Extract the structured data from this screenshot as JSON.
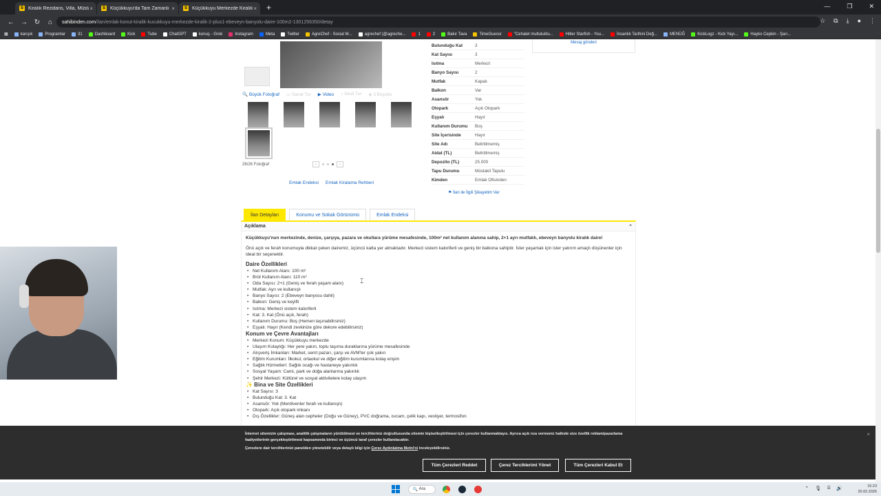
{
  "browser": {
    "tabs": [
      {
        "label": "Kiralık Rezidans, Villa, Müstakil",
        "favicon": "S"
      },
      {
        "label": "Küçükkuyu'da Tam Zamanlı Kira",
        "favicon": "S"
      },
      {
        "label": "Küçükkuyu Merkezde Kiralık 2+",
        "favicon": "S"
      }
    ],
    "new_tab": "+",
    "url_host": "sahibinden.com",
    "url_path": "/ilan/emlak-konut-kiralik-kucukkuyu-merkezde-kiralik-2-plus1-ebeveyn-banyolu-daire-100m2-1301256350/detay",
    "bookmarks": [
      {
        "label": "karışık",
        "color": "#8ab4f8"
      },
      {
        "label": "Programlar",
        "color": "#8ab4f8"
      },
      {
        "label": "31",
        "color": "#8ab4f8"
      },
      {
        "label": "Dashboard",
        "color": "#53fc18"
      },
      {
        "label": "Kick",
        "color": "#53fc18"
      },
      {
        "label": "Tube",
        "color": "#ff0000"
      },
      {
        "label": "ChatGPT",
        "color": "#ffffff"
      },
      {
        "label": "konuş - Grok",
        "color": "#ffffff"
      },
      {
        "label": "Instagram",
        "color": "#e1306c"
      },
      {
        "label": "Meta",
        "color": "#0866ff"
      },
      {
        "label": "Twitter",
        "color": "#ffffff"
      },
      {
        "label": "AgreChef - Social M...",
        "color": "#f5c300"
      },
      {
        "label": "agrechef (@agreche...",
        "color": "#ffffff"
      },
      {
        "label": "1",
        "color": "#ff0000"
      },
      {
        "label": "2",
        "color": "#ff0000"
      },
      {
        "label": "Bakır Tava",
        "color": "#53fc18"
      },
      {
        "label": "TimeGuessr",
        "color": "#f5c300"
      },
      {
        "label": "\"Cehalet mutluluktu...",
        "color": "#ff0000"
      },
      {
        "label": "Hitler Starfish - You...",
        "color": "#ff0000"
      },
      {
        "label": "İnsanlık Tarihini Değ...",
        "color": "#ff0000"
      },
      {
        "label": "MENÜĞ",
        "color": "#8ab4f8"
      },
      {
        "label": "KickLogz - Kick Yayı...",
        "color": "#53fc18"
      },
      {
        "label": "Hayko Cepkin - Şarı...",
        "color": "#53fc18"
      }
    ]
  },
  "gallery": {
    "actions": [
      "Büyük Fotoğraf",
      "Sanal Tur",
      "Video",
      "Sesli Tur",
      "3 Boyutlu"
    ],
    "photo_count": "26/26 Fotoğraf",
    "links": [
      "Emlak Endeksi",
      "Emlak Kiralama Rehberi"
    ]
  },
  "properties": [
    {
      "k": "Bulunduğu Kat",
      "v": "3"
    },
    {
      "k": "Kat Sayısı",
      "v": "3"
    },
    {
      "k": "Isıtma",
      "v": "Merkezi"
    },
    {
      "k": "Banyo Sayısı",
      "v": "2"
    },
    {
      "k": "Mutfak",
      "v": "Kapalı"
    },
    {
      "k": "Balkon",
      "v": "Var"
    },
    {
      "k": "Asansör",
      "v": "Yok"
    },
    {
      "k": "Otopark",
      "v": "Açık Otopark"
    },
    {
      "k": "Eşyalı",
      "v": "Hayır"
    },
    {
      "k": "Kullanım Durumu",
      "v": "Boş"
    },
    {
      "k": "Site İçerisinde",
      "v": "Hayır"
    },
    {
      "k": "Site Adı",
      "v": "Belirtilmemiş"
    },
    {
      "k": "Aidat (TL)",
      "v": "Belirtilmemiş"
    },
    {
      "k": "Depozito (TL)",
      "v": "25.000"
    },
    {
      "k": "Tapu Durumu",
      "v": "Müstakil Tapulu"
    },
    {
      "k": "Kimden",
      "v": "Emlak Ofisinden"
    }
  ],
  "report_link": "İlan ile İlgili Şikayetim Var",
  "sidebox_link": "Mesaj gönderi",
  "detail_tabs": [
    "İlan Detayları",
    "Konumu ve Sokak Görünümü",
    "Emlak Endeksi"
  ],
  "description": {
    "title": "Açıklama",
    "lead": "Küçükkuyu'nun merkezinde, denize, çarşıya, pazara ve okullara yürüme mesafesinde, 100m² net kullanım alanına sahip, 2+1 ayrı mutfaklı, ebeveyn banyolu kiralık daire!",
    "para": "Önü açık ve ferah konumuyla dikkat çeken dairemiz, üçüncü katta yer almaktadır. Merkezi sistem kaloriferli ve geniş bir balkona sahiptir. İster yaşamak için ister yatırım amaçlı düşünenler için ideal bir seçenektir.",
    "sections": [
      {
        "title": "Daire Özellikleri",
        "items": [
          "Net Kullanım Alanı: 100 m²",
          "Brüt Kullanım Alanı: 110 m²",
          "Oda Sayısı: 2+1 (Geniş ve ferah yaşam alanı)",
          "Mutfak: Ayrı ve kullanışlı",
          "Banyo Sayısı: 2 (Ebeveyn banyosu dahil)",
          "Balkon: Geniş ve keyifli",
          "Isıtma: Merkezi sistem kaloriferli",
          "Kat: 3. Kat (Önü açık, ferah)",
          "Kullanım Durumu: Boş (Hemen taşınabilirsiniz)",
          "Eşyalı: Hayır (Kendi zevkinize göre dekore edebilirsiniz)"
        ]
      },
      {
        "title": "Konum ve Çevre Avantajları",
        "items": [
          "Merkezi Konum: Küçükkuyu merkezde",
          "Ulaşım Kolaylığı: Her yere yakın, toplu taşıma duraklarına yürüme mesafesinde",
          "Alışveriş İmkanları: Market, semt pazarı, çarşı ve AVM'ler çok yakın",
          "Eğitim Kurumları: İlkokul, ortaokul ve diğer eğitim kurumlarına kolay erişim",
          "Sağlık Hizmetleri: Sağlık ocağı ve hastaneye yakınlık",
          "Sosyal Yaşam: Cami, park ve doğa alanlarına yakınlık",
          "Şehir Merkezi: Kültürel ve sosyal aktivitelere kolay ulaşım"
        ]
      },
      {
        "title": "✨ Bina ve Site Özellikleri",
        "items": [
          "Kat Sayısı: 3",
          "Bulunduğu Kat: 3. Kat",
          "Asansör: Yok (Merdivenler ferah ve kullanışlı)",
          "Otopark: Açık otopark imkanı",
          "Dış Özellikler: Güneş alan cepheler (Doğu ve Güney), PVC doğrama, ısıcam, çelik kapı, vestiyer, termosifon"
        ]
      }
    ]
  },
  "cookie": {
    "text": "İnternet sitemizin çalışması, analitik çalışmaların yürütülmesi ve tercihleriniz doğrultusunda sitemin kişiselleştirilmesi için çerezler kullanmaktayız. Ayrıca açık rıza vermeniz halinde size özellik reklam/pazarlama faaliyetlerinin gerçekleştirilmesi kapsamında birinci ve üçüncü taraf çerezler kullanılacaktır.",
    "text2_pre": "Çerezlere dair tercihlerinizi panelden yönetebilir veya detaylı bilgi için ",
    "text2_link": "Çerez Aydınlatma Metni'ni",
    "text2_post": " inceleyebilirsiniz.",
    "buttons": [
      "Tüm Çerezleri Reddet",
      "Çerez Tercihlerimi Yönet",
      "Tüm Çerezleri Kabul Et"
    ],
    "close": "×"
  },
  "taskbar": {
    "search": "Ara",
    "time": "16:23",
    "date": "20.02.2026"
  }
}
